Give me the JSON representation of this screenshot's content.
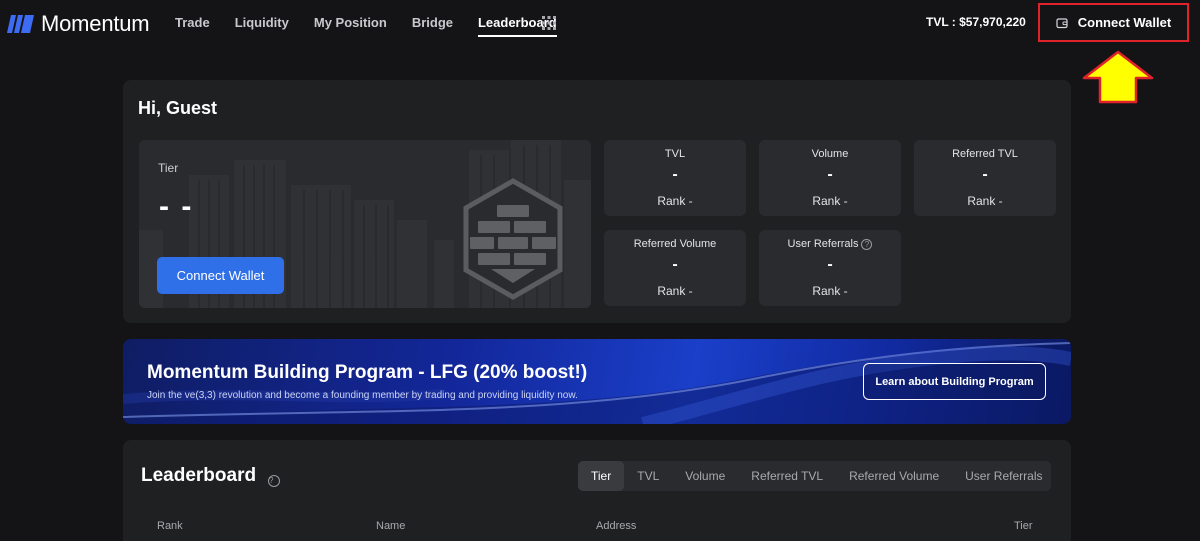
{
  "app": {
    "brand": "Momentum",
    "colors": {
      "accent": "#2f6fe8",
      "annotation": "#ffff00",
      "highlight_border": "#e0222b"
    }
  },
  "nav": {
    "items": [
      {
        "label": "Trade",
        "active": false
      },
      {
        "label": "Liquidity",
        "active": false
      },
      {
        "label": "My Position",
        "active": false
      },
      {
        "label": "Bridge",
        "active": false
      },
      {
        "label": "Leaderboard",
        "active": true
      }
    ],
    "more_icon": "grid-dots-icon"
  },
  "header": {
    "tvl": "TVL : $57,970,220",
    "connect_wallet": "Connect Wallet",
    "wallet_icon": "wallet-icon"
  },
  "profile": {
    "greeting": "Hi, Guest",
    "tier_label": "Tier",
    "tier_value": "- -",
    "connect_wallet": "Connect Wallet",
    "stats": [
      {
        "title": "TVL",
        "value": "-",
        "rank": "Rank  -"
      },
      {
        "title": "Volume",
        "value": "-",
        "rank": "Rank  -"
      },
      {
        "title": "Referred TVL",
        "value": "-",
        "rank": "Rank  -"
      },
      {
        "title": "Referred Volume",
        "value": "-",
        "rank": "Rank  -"
      },
      {
        "title": "User Referrals",
        "value": "-",
        "rank": "Rank  -",
        "help": "?"
      }
    ]
  },
  "banner": {
    "title": "Momentum Building Program - LFG (20% boost!)",
    "subtitle": "Join the ve(3,3) revolution and become a founding member by trading and providing liquidity now.",
    "button": "Learn about Building Program"
  },
  "leaderboard": {
    "title": "Leaderboard",
    "help": "?",
    "tabs": [
      {
        "label": "Tier",
        "active": true
      },
      {
        "label": "TVL",
        "active": false
      },
      {
        "label": "Volume",
        "active": false
      },
      {
        "label": "Referred TVL",
        "active": false
      },
      {
        "label": "Referred Volume",
        "active": false
      },
      {
        "label": "User Referrals",
        "active": false
      }
    ],
    "columns": [
      "Rank",
      "Name",
      "Address",
      "Tier"
    ]
  }
}
